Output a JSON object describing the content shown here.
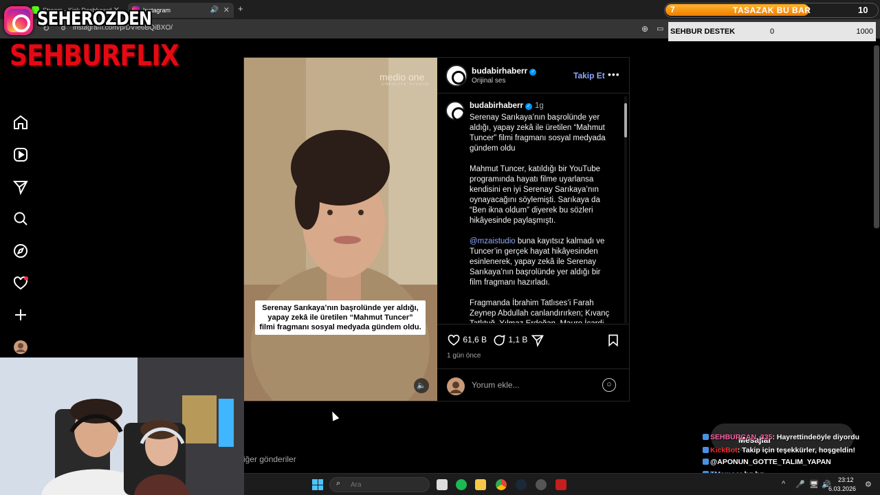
{
  "browser": {
    "tabs": [
      {
        "label": "Stream - Kick Dashboard"
      },
      {
        "label": "Instagram"
      }
    ],
    "new_tab": "+",
    "url": "instagram.com/p/DVfe6BQiBXO/",
    "window_controls": [
      "—",
      "▢",
      "✕"
    ]
  },
  "overlay": {
    "streamer_name": "SEHEROZDEN",
    "brand": "SEHBURFLIX",
    "bar": {
      "start": "7",
      "title": "TASAZAK BU BAR",
      "end": "10",
      "progress_fraction": 0.68
    },
    "destek": {
      "label": "SEHBUR DESTEK",
      "current": "0",
      "goal": "1000"
    }
  },
  "sidebar": {
    "items": [
      {
        "icon": "home-icon"
      },
      {
        "icon": "reels-icon"
      },
      {
        "icon": "messages-icon"
      },
      {
        "icon": "search-icon"
      },
      {
        "icon": "explore-icon"
      },
      {
        "icon": "notifications-icon"
      },
      {
        "icon": "create-icon"
      },
      {
        "icon": "profile-icon"
      }
    ]
  },
  "post": {
    "media": {
      "watermark": "medio one",
      "watermark_sub": "CREATIVE STUDIO",
      "caption_card": "Serenay Sarıkaya’nın başrolünde yer aldığı, yapay zekâ ile üretilen “Mahmut Tuncer” filmi fragmanı sosyal medyada gündem oldu."
    },
    "header": {
      "username": "budabirhaberr",
      "subtitle": "Orijinal ses",
      "follow_label": "Takip Et",
      "more_label": "•••"
    },
    "caption": {
      "username": "budabirhaberr",
      "time": "1g",
      "p1": "Serenay Sarıkaya’nın başrolünde yer aldığı, yapay zekâ ile üretilen “Mahmut Tuncer” filmi fragmanı sosyal medyada gündem oldu",
      "p2": "Mahmut Tuncer, katıldığı bir YouTube programında hayatı filme uyarlansa kendisini en iyi Serenay Sarıkaya’nın oynayacağını söylemişti. Sarıkaya da “Ben ikna oldum” diyerek bu sözleri hikâyesinde paylaşmıştı.",
      "p3_mention": "@mzaistudio",
      "p3_rest": " buna kayıtsız kalmadı ve Tuncer’in gerçek hayat hikâyesinden esinlenerek, yapay zekâ ile Serenay Sarıkaya’nın başrolünde yer aldığı bir film fragmanı hazırladı.",
      "p4": "Fragmanda İbrahim Tatlıses’i Farah Zeynep Abdullah canlandırırken; Kıvanç Tatlıtuğ, Yılmaz Erdoğan, Mauro İcardi"
    },
    "actions": {
      "likes": "61,6 B",
      "comments": "1,1 B",
      "posted": "1 gün önce",
      "comment_placeholder": "Yorum ekle..."
    },
    "other_posts": "iğer gönderiler"
  },
  "chat": {
    "panel_label": "Mesajlar",
    "messages": [
      {
        "user": "SEHBURCAN_335",
        "text": ": Hayrettindeöyle diyordu",
        "color": "#ff5fa2"
      },
      {
        "user": "KickBot",
        "text": ": Takip için teşekkürler, hoşgeldin!",
        "color": "#ff2a2a"
      },
      {
        "user": "",
        "text": "@APONUN_GOTTE_TALIM_YAPAN",
        "color": "#ffffff"
      },
      {
        "user": "TMemoo",
        "text": ": hg hg",
        "color": "#8fb8ff"
      },
      {
        "user": "TMemoo",
        "text": ":",
        "color": "#8fb8ff"
      }
    ]
  },
  "taskbar": {
    "search_placeholder": "Ara",
    "time": "23:12",
    "date": "6.03.2026"
  },
  "colors": {
    "accent_blue": "#0095f6",
    "follow": "#8fa8ff",
    "brand_red": "#e50914",
    "bar_orange": "#f07c00"
  }
}
